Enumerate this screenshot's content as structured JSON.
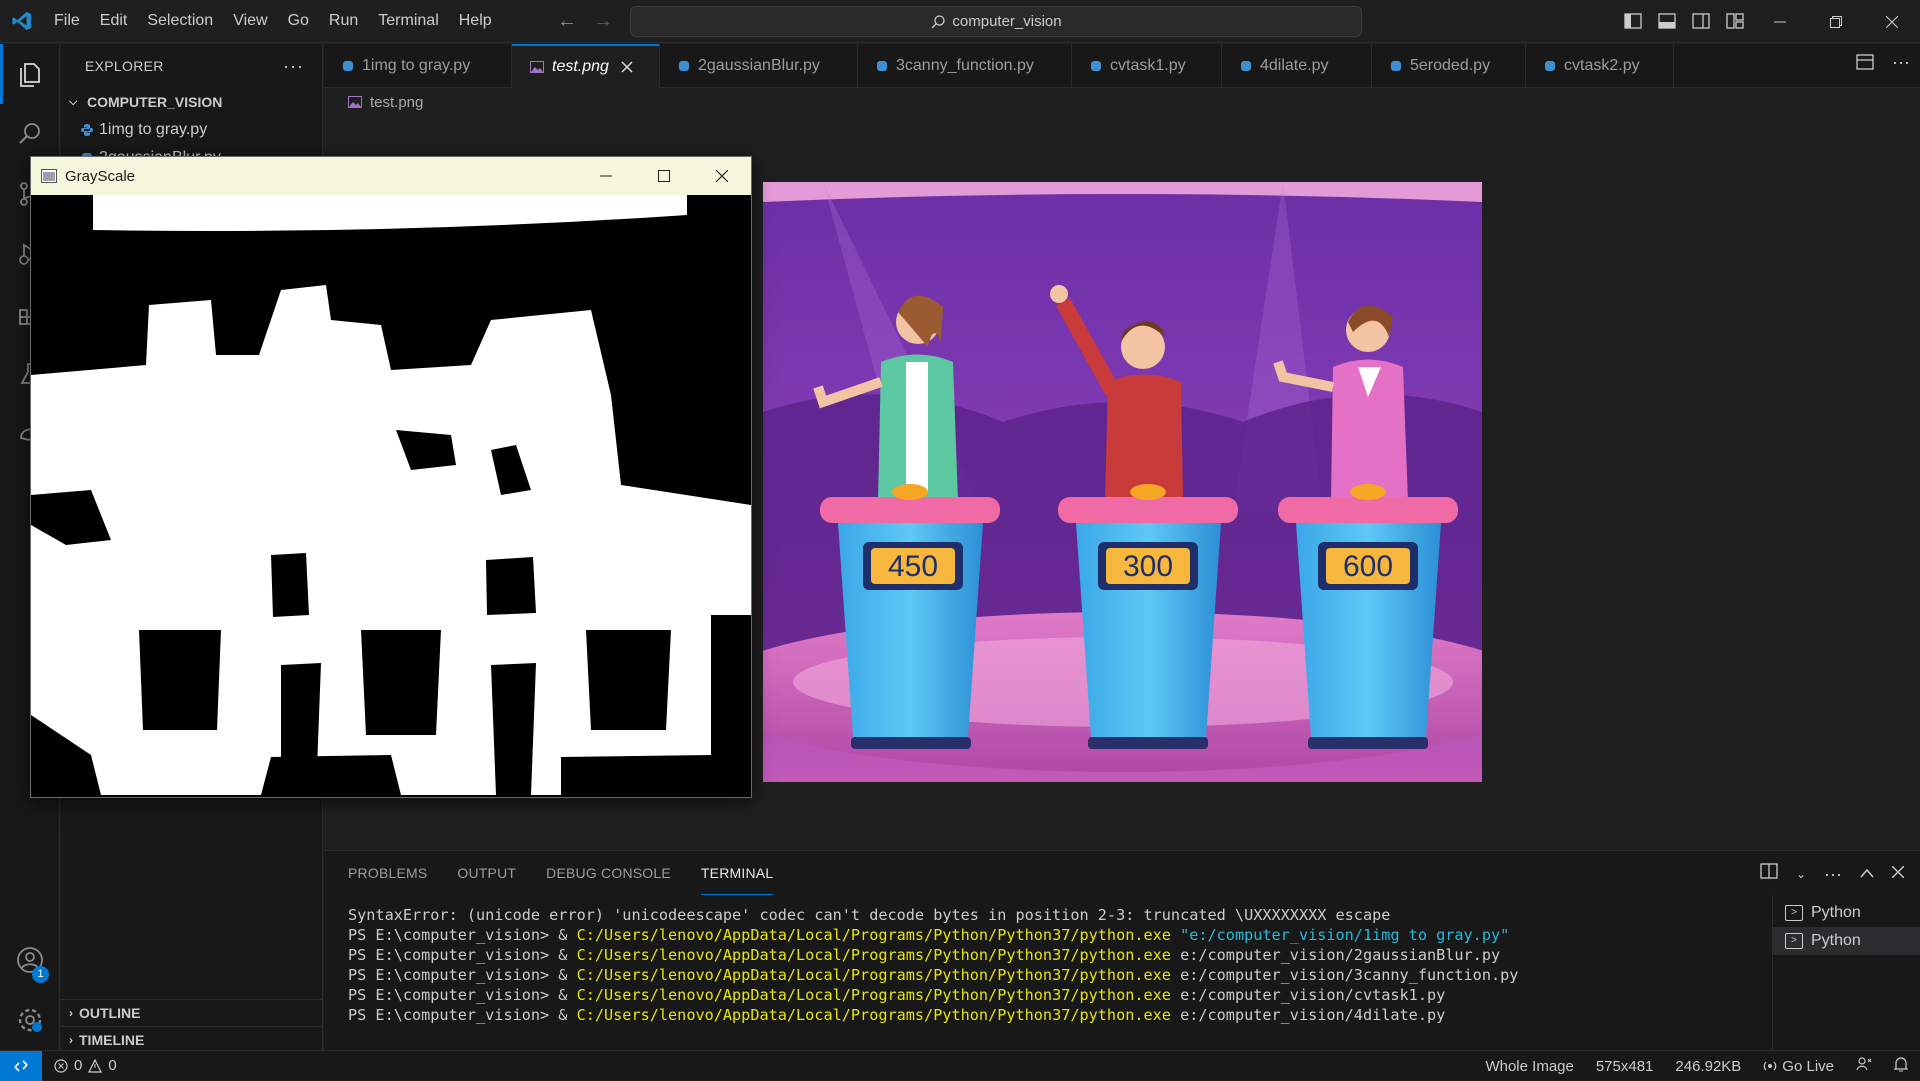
{
  "menu": [
    "File",
    "Edit",
    "Selection",
    "View",
    "Go",
    "Run",
    "Terminal",
    "Help"
  ],
  "search": {
    "text": "computer_vision"
  },
  "sidebar": {
    "title": "EXPLORER",
    "root": "COMPUTER_VISION",
    "items": [
      {
        "label": "1img to gray.py"
      },
      {
        "label": "2gaussianBlur.py"
      }
    ],
    "outline": "OUTLINE",
    "timeline": "TIMELINE",
    "accounts_badge": "1"
  },
  "tabs": [
    {
      "label": "1img to gray.py"
    },
    {
      "label": "test.png"
    },
    {
      "label": "2gaussianBlur.py"
    },
    {
      "label": "3canny_function.py"
    },
    {
      "label": "cvtask1.py"
    },
    {
      "label": "4dilate.py"
    },
    {
      "label": "5eroded.py"
    },
    {
      "label": "cvtask2.py"
    }
  ],
  "editor": {
    "breadcrumb": "test.png",
    "podium_scores": [
      "450",
      "300",
      "600"
    ]
  },
  "grayscale_window": {
    "title": "GrayScale"
  },
  "panel": {
    "tabs": [
      "PROBLEMS",
      "OUTPUT",
      "DEBUG CONSOLE",
      "TERMINAL"
    ],
    "lines": [
      {
        "plain": "SyntaxError: (unicode error) 'unicodeescape' codec can't decode bytes in position 2-3: truncated \\UXXXXXXXX escape"
      },
      {
        "prompt": "PS E:\\computer_vision> & ",
        "exe": "C:/Users/lenovo/AppData/Local/Programs/Python/Python37/python.exe",
        "arg": " \"e:/computer_vision/1img to gray.py\"",
        "quoted": true
      },
      {
        "prompt": "PS E:\\computer_vision> & ",
        "exe": "C:/Users/lenovo/AppData/Local/Programs/Python/Python37/python.exe",
        "arg": " e:/computer_vision/2gaussianBlur.py",
        "quoted": false
      },
      {
        "prompt": "PS E:\\computer_vision> & ",
        "exe": "C:/Users/lenovo/AppData/Local/Programs/Python/Python37/python.exe",
        "arg": " e:/computer_vision/3canny_function.py",
        "quoted": false
      },
      {
        "prompt": "PS E:\\computer_vision> & ",
        "exe": "C:/Users/lenovo/AppData/Local/Programs/Python/Python37/python.exe",
        "arg": " e:/computer_vision/cvtask1.py",
        "quoted": false
      },
      {
        "prompt": "PS E:\\computer_vision> & ",
        "exe": "C:/Users/lenovo/AppData/Local/Programs/Python/Python37/python.exe",
        "arg": " e:/computer_vision/4dilate.py",
        "quoted": false
      }
    ],
    "terminals": [
      "Python",
      "Python"
    ]
  },
  "status": {
    "errors": "0",
    "warnings": "0",
    "view_mode": "Whole Image",
    "dimensions": "575x481",
    "file_size": "246.92KB",
    "go_live": "Go Live"
  },
  "colors": {
    "accent": "#0078d4",
    "terminal_yellow": "#e5e510",
    "terminal_cyan": "#29b8db"
  }
}
